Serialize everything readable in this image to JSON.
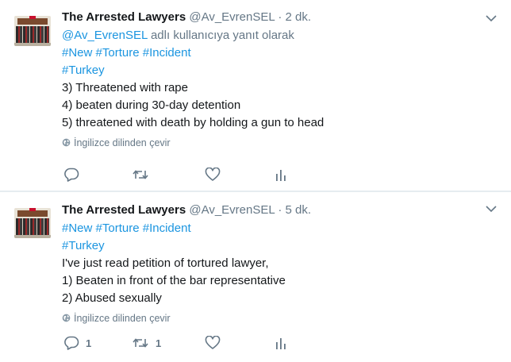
{
  "tweets": [
    {
      "name": "The Arrested Lawyers",
      "handle": "@Av_EvrenSEL",
      "dot": "·",
      "time": "2 dk.",
      "reply_to": {
        "mention": "@Av_EvrenSEL",
        "rest": "adlı kullanıcıya yanıt olarak"
      },
      "lines": [
        {
          "tags": [
            "#New",
            "#Torture",
            "#Incident"
          ]
        },
        {
          "tags": [
            "#Turkey"
          ]
        },
        {
          "text": "3) Threatened with rape"
        },
        {
          "text": "4) beaten during 30-day detention"
        },
        {
          "text": "5) threatened with death by holding a gun to head"
        }
      ],
      "translate": "İngilizce dilinden çevir",
      "reply_count": "",
      "retweet_count": "",
      "like_count": ""
    },
    {
      "name": "The Arrested Lawyers",
      "handle": "@Av_EvrenSEL",
      "dot": "·",
      "time": "5 dk.",
      "lines": [
        {
          "tags": [
            "#New",
            "#Torture",
            "#Incident"
          ]
        },
        {
          "tags": [
            "#Turkey"
          ]
        },
        {
          "text": "I've just read petition of tortured lawyer,"
        },
        {
          "text": "1) Beaten in front of the bar representative"
        },
        {
          "text": "2) Abused sexually"
        }
      ],
      "translate": "İngilizce dilinden çevir",
      "reply_count": "1",
      "retweet_count": "1",
      "like_count": ""
    }
  ],
  "icons": {
    "avatar": "courthouse-avatar",
    "menu": "chevron-down-icon",
    "translate": "globe-icon",
    "reply": "reply-icon",
    "retweet": "retweet-icon",
    "like": "heart-icon",
    "stats": "analytics-icon"
  },
  "colors": {
    "link": "#1b95e0",
    "secondary": "#657786",
    "text": "#14171a",
    "divider": "#e6ecf0"
  }
}
